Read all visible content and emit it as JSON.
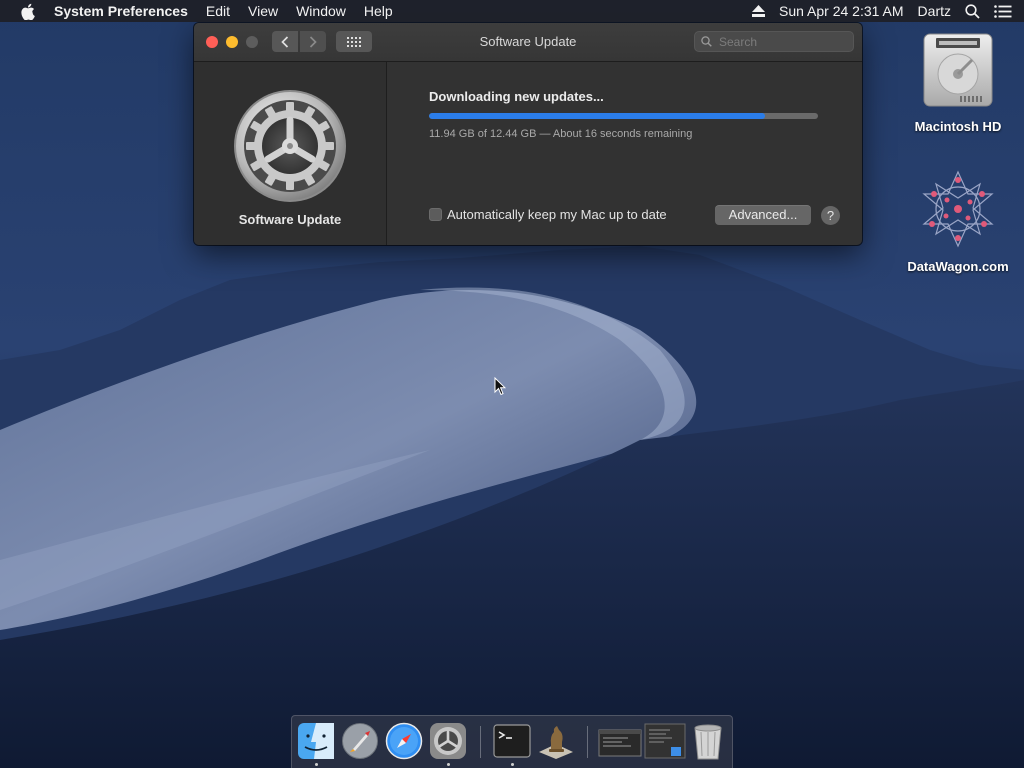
{
  "menubar": {
    "app_name": "System Preferences",
    "menus": [
      "Edit",
      "View",
      "Window",
      "Help"
    ],
    "clock": "Sun Apr 24  2:31 AM",
    "user": "Dartz"
  },
  "window": {
    "title": "Software Update",
    "search_placeholder": "Search",
    "pane_label": "Software Update",
    "status": "Downloading new updates...",
    "progress_fraction": 0.865,
    "progress_detail": "11.94 GB of 12.44 GB — About 16 seconds remaining",
    "auto_update_label": "Automatically keep my Mac up to date",
    "auto_update_checked": false,
    "advanced_button": "Advanced...",
    "help_button": "?"
  },
  "desktop": {
    "icons": [
      {
        "label": "Macintosh HD",
        "icon": "hard-drive-icon"
      },
      {
        "label": "DataWagon.com",
        "icon": "network-star-icon"
      }
    ]
  },
  "dock": {
    "items": [
      {
        "icon": "finder-icon",
        "running": true
      },
      {
        "icon": "launchpad-icon",
        "running": false
      },
      {
        "icon": "safari-icon",
        "running": false
      },
      {
        "icon": "system-preferences-icon",
        "running": true
      },
      {
        "icon": "terminal-icon",
        "running": true
      },
      {
        "icon": "chess-icon",
        "running": false
      },
      {
        "icon": "window-thumbnail-icon",
        "running": false
      },
      {
        "icon": "document-thumbnail-icon",
        "running": false
      },
      {
        "icon": "trash-icon",
        "running": false
      }
    ]
  },
  "colors": {
    "progress": "#2b7de9",
    "close": "#ff5f57",
    "minimize": "#febc2e"
  }
}
